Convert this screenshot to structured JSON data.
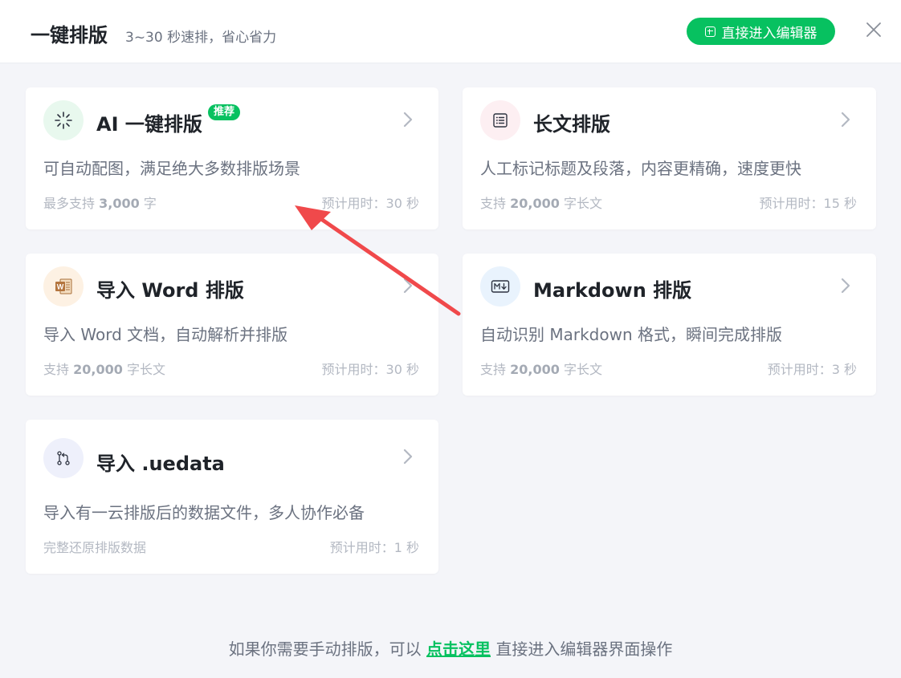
{
  "header": {
    "title": "一键排版",
    "subtitle": "3~30 秒速排，省心省力",
    "enter_editor_label": "直接进入编辑器",
    "accent_color": "#07c160"
  },
  "cards": [
    {
      "title": "AI 一键排版",
      "badge": "推荐",
      "description": "可自动配图，满足绝大多数排版场景",
      "limit_prefix": "最多支持",
      "limit_value": "3,000",
      "limit_suffix": "字",
      "eta": "预计用时：30 秒",
      "icon": "ai-sparkle-icon"
    },
    {
      "title": "长文排版",
      "description": "人工标记标题及段落，内容更精确，速度更快",
      "limit_prefix": "支持",
      "limit_value": "20,000",
      "limit_suffix": "字长文",
      "eta": "预计用时：15 秒",
      "icon": "list-document-icon"
    },
    {
      "title": "导入 Word 排版",
      "description": "导入 Word 文档，自动解析并排版",
      "limit_prefix": "支持",
      "limit_value": "20,000",
      "limit_suffix": "字长文",
      "eta": "预计用时：30 秒",
      "icon": "word-file-icon"
    },
    {
      "title": "Markdown 排版",
      "description": "自动识别 Markdown 格式，瞬间完成排版",
      "limit_prefix": "支持",
      "limit_value": "20,000",
      "limit_suffix": "字长文",
      "eta": "预计用时：3 秒",
      "icon": "markdown-icon"
    },
    {
      "title": "导入 .uedata",
      "description": "导入有一云排版后的数据文件，多人协作必备",
      "limit_text": "完整还原排版数据",
      "eta": "预计用时：1 秒",
      "icon": "data-branch-icon"
    }
  ],
  "footer": {
    "prefix": "如果你需要手动排版，可以",
    "link": "点击这里",
    "suffix": "直接进入编辑器界面操作"
  },
  "annotation": {
    "arrow_color": "#f0494b"
  }
}
